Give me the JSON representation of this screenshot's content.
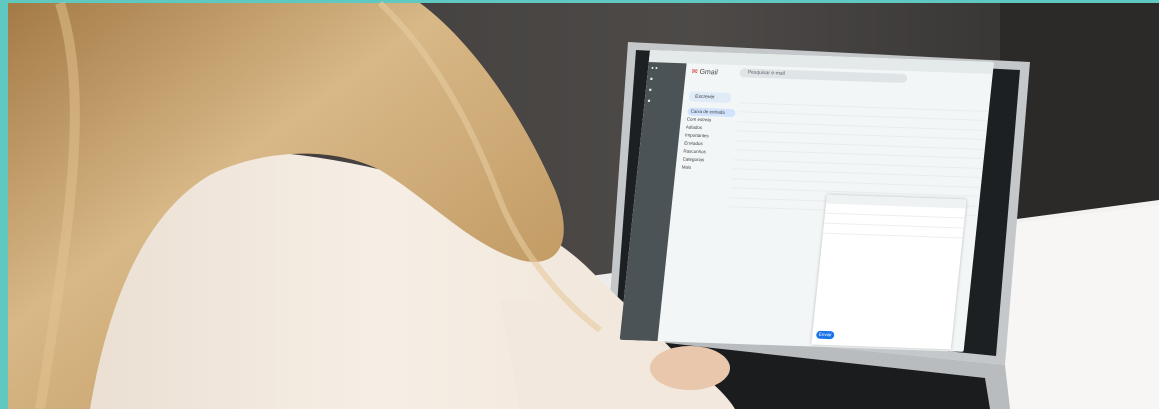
{
  "scene": {
    "colors": {
      "accent_border": "#5fc8c0",
      "wall": "#4a4746",
      "laptop_body": "#c8cbcd",
      "sweater": "#efe6dc",
      "hair": "#c7a06a"
    }
  },
  "gmail": {
    "app_name": "Gmail",
    "search_placeholder": "Pesquisar e-mail",
    "compose_label": "Escrever",
    "nav": [
      "Caixa de entrada",
      "Com estrela",
      "Adiados",
      "Importantes",
      "Enviados",
      "Rascunhos",
      "Categorias",
      "Mais"
    ],
    "send_label": "Enviar"
  }
}
